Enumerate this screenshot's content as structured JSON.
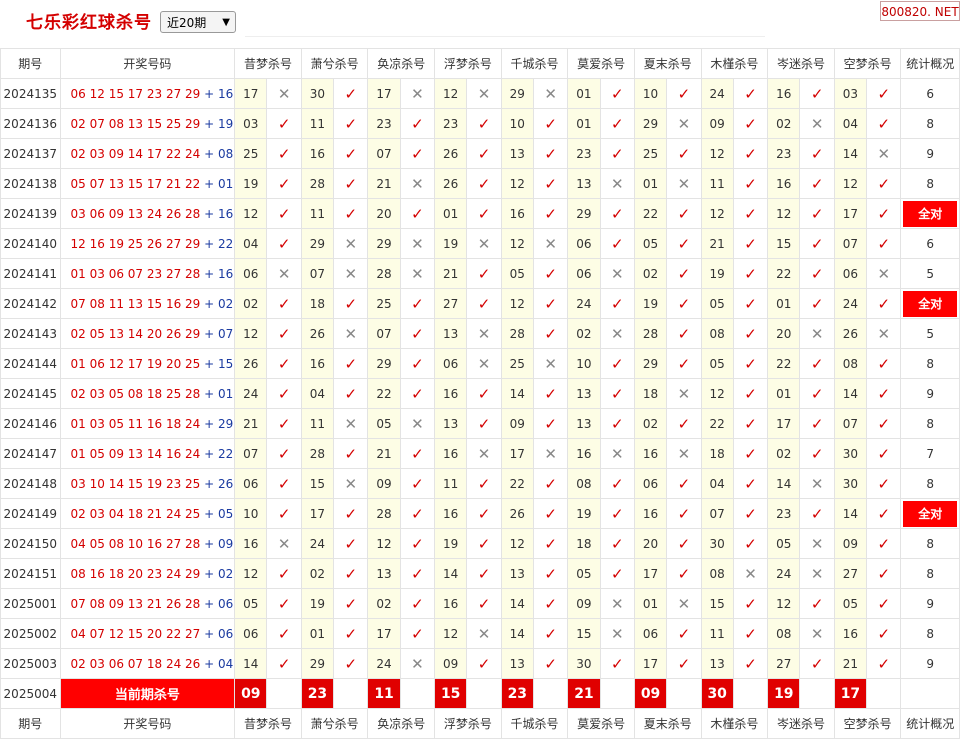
{
  "header": {
    "title": "七乐彩红球杀号",
    "period_select": "近20期",
    "site": "800820. NET"
  },
  "columns": {
    "issue": "期号",
    "numbers": "开奖号码",
    "experts": [
      "昔梦杀号",
      "萧兮杀号",
      "奂凉杀号",
      "浮梦杀号",
      "千城杀号",
      "莫爱杀号",
      "夏末杀号",
      "木槿杀号",
      "岑迷杀号",
      "空梦杀号"
    ],
    "stats": "统计概况"
  },
  "rows": [
    {
      "issue": "2024135",
      "reds": "06 12 15 17 23 27 29",
      "blue": "16",
      "kills": [
        "17",
        "30",
        "17",
        "12",
        "29",
        "01",
        "10",
        "24",
        "16",
        "03"
      ],
      "marks": [
        "n",
        "y",
        "n",
        "n",
        "n",
        "y",
        "y",
        "y",
        "y",
        "y"
      ],
      "stat": "6"
    },
    {
      "issue": "2024136",
      "reds": "02 07 08 13 15 25 29",
      "blue": "19",
      "kills": [
        "03",
        "11",
        "23",
        "23",
        "10",
        "01",
        "29",
        "09",
        "02",
        "04"
      ],
      "marks": [
        "y",
        "y",
        "y",
        "y",
        "y",
        "y",
        "n",
        "y",
        "n",
        "y"
      ],
      "stat": "8"
    },
    {
      "issue": "2024137",
      "reds": "02 03 09 14 17 22 24",
      "blue": "08",
      "kills": [
        "25",
        "16",
        "07",
        "26",
        "13",
        "23",
        "25",
        "12",
        "23",
        "14"
      ],
      "marks": [
        "y",
        "y",
        "y",
        "y",
        "y",
        "y",
        "y",
        "y",
        "y",
        "n"
      ],
      "stat": "9"
    },
    {
      "issue": "2024138",
      "reds": "05 07 13 15 17 21 22",
      "blue": "01",
      "kills": [
        "19",
        "28",
        "21",
        "26",
        "12",
        "13",
        "01",
        "11",
        "16",
        "12"
      ],
      "marks": [
        "y",
        "y",
        "n",
        "y",
        "y",
        "n",
        "n",
        "y",
        "y",
        "y"
      ],
      "stat": "8"
    },
    {
      "issue": "2024139",
      "reds": "03 06 09 13 24 26 28",
      "blue": "16",
      "kills": [
        "12",
        "11",
        "20",
        "01",
        "16",
        "29",
        "22",
        "12",
        "12",
        "17"
      ],
      "marks": [
        "y",
        "y",
        "y",
        "y",
        "y",
        "y",
        "y",
        "y",
        "y",
        "y"
      ],
      "stat": "全对"
    },
    {
      "issue": "2024140",
      "reds": "12 16 19 25 26 27 29",
      "blue": "22",
      "kills": [
        "04",
        "29",
        "29",
        "19",
        "12",
        "06",
        "05",
        "21",
        "15",
        "07"
      ],
      "marks": [
        "y",
        "n",
        "n",
        "n",
        "n",
        "y",
        "y",
        "y",
        "y",
        "y"
      ],
      "stat": "6"
    },
    {
      "issue": "2024141",
      "reds": "01 03 06 07 23 27 28",
      "blue": "16",
      "kills": [
        "06",
        "07",
        "28",
        "21",
        "05",
        "06",
        "02",
        "19",
        "22",
        "06"
      ],
      "marks": [
        "n",
        "n",
        "n",
        "y",
        "y",
        "n",
        "y",
        "y",
        "y",
        "n"
      ],
      "stat": "5"
    },
    {
      "issue": "2024142",
      "reds": "07 08 11 13 15 16 29",
      "blue": "02",
      "kills": [
        "02",
        "18",
        "25",
        "27",
        "12",
        "24",
        "19",
        "05",
        "01",
        "24"
      ],
      "marks": [
        "y",
        "y",
        "y",
        "y",
        "y",
        "y",
        "y",
        "y",
        "y",
        "y"
      ],
      "stat": "全对"
    },
    {
      "issue": "2024143",
      "reds": "02 05 13 14 20 26 29",
      "blue": "07",
      "kills": [
        "12",
        "26",
        "07",
        "13",
        "28",
        "02",
        "28",
        "08",
        "20",
        "26"
      ],
      "marks": [
        "y",
        "n",
        "y",
        "n",
        "y",
        "n",
        "y",
        "y",
        "n",
        "n"
      ],
      "stat": "5"
    },
    {
      "issue": "2024144",
      "reds": "01 06 12 17 19 20 25",
      "blue": "15",
      "kills": [
        "26",
        "16",
        "29",
        "06",
        "25",
        "10",
        "29",
        "05",
        "22",
        "08"
      ],
      "marks": [
        "y",
        "y",
        "y",
        "n",
        "n",
        "y",
        "y",
        "y",
        "y",
        "y"
      ],
      "stat": "8"
    },
    {
      "issue": "2024145",
      "reds": "02 03 05 08 18 25 28",
      "blue": "01",
      "kills": [
        "24",
        "04",
        "22",
        "16",
        "14",
        "13",
        "18",
        "12",
        "01",
        "14"
      ],
      "marks": [
        "y",
        "y",
        "y",
        "y",
        "y",
        "y",
        "n",
        "y",
        "y",
        "y"
      ],
      "stat": "9"
    },
    {
      "issue": "2024146",
      "reds": "01 03 05 11 16 18 24",
      "blue": "29",
      "kills": [
        "21",
        "11",
        "05",
        "13",
        "09",
        "13",
        "02",
        "22",
        "17",
        "07"
      ],
      "marks": [
        "y",
        "n",
        "n",
        "y",
        "y",
        "y",
        "y",
        "y",
        "y",
        "y"
      ],
      "stat": "8"
    },
    {
      "issue": "2024147",
      "reds": "01 05 09 13 14 16 24",
      "blue": "22",
      "kills": [
        "07",
        "28",
        "21",
        "16",
        "17",
        "16",
        "16",
        "18",
        "02",
        "30"
      ],
      "marks": [
        "y",
        "y",
        "y",
        "n",
        "n",
        "n",
        "n",
        "y",
        "y",
        "y"
      ],
      "stat": "7"
    },
    {
      "issue": "2024148",
      "reds": "03 10 14 15 19 23 25",
      "blue": "26",
      "kills": [
        "06",
        "15",
        "09",
        "11",
        "22",
        "08",
        "06",
        "04",
        "14",
        "30"
      ],
      "marks": [
        "y",
        "n",
        "y",
        "y",
        "y",
        "y",
        "y",
        "y",
        "n",
        "y"
      ],
      "stat": "8"
    },
    {
      "issue": "2024149",
      "reds": "02 03 04 18 21 24 25",
      "blue": "05",
      "kills": [
        "10",
        "17",
        "28",
        "16",
        "26",
        "19",
        "16",
        "07",
        "23",
        "14"
      ],
      "marks": [
        "y",
        "y",
        "y",
        "y",
        "y",
        "y",
        "y",
        "y",
        "y",
        "y"
      ],
      "stat": "全对"
    },
    {
      "issue": "2024150",
      "reds": "04 05 08 10 16 27 28",
      "blue": "09",
      "kills": [
        "16",
        "24",
        "12",
        "19",
        "12",
        "18",
        "20",
        "30",
        "05",
        "09"
      ],
      "marks": [
        "n",
        "y",
        "y",
        "y",
        "y",
        "y",
        "y",
        "y",
        "n",
        "y"
      ],
      "stat": "8"
    },
    {
      "issue": "2024151",
      "reds": "08 16 18 20 23 24 29",
      "blue": "02",
      "kills": [
        "12",
        "02",
        "13",
        "14",
        "13",
        "05",
        "17",
        "08",
        "24",
        "27"
      ],
      "marks": [
        "y",
        "y",
        "y",
        "y",
        "y",
        "y",
        "y",
        "n",
        "n",
        "y"
      ],
      "stat": "8"
    },
    {
      "issue": "2025001",
      "reds": "07 08 09 13 21 26 28",
      "blue": "06",
      "kills": [
        "05",
        "19",
        "02",
        "16",
        "14",
        "09",
        "01",
        "15",
        "12",
        "05"
      ],
      "marks": [
        "y",
        "y",
        "y",
        "y",
        "y",
        "n",
        "n",
        "y",
        "y",
        "y"
      ],
      "stat": "9"
    },
    {
      "issue": "2025002",
      "reds": "04 07 12 15 20 22 27",
      "blue": "06",
      "kills": [
        "06",
        "01",
        "17",
        "12",
        "14",
        "15",
        "06",
        "11",
        "08",
        "16"
      ],
      "marks": [
        "y",
        "y",
        "y",
        "n",
        "y",
        "n",
        "y",
        "y",
        "n",
        "y"
      ],
      "stat": "8"
    },
    {
      "issue": "2025003",
      "reds": "02 03 06 07 18 24 26",
      "blue": "04",
      "kills": [
        "14",
        "29",
        "24",
        "09",
        "13",
        "30",
        "17",
        "13",
        "27",
        "21"
      ],
      "marks": [
        "y",
        "y",
        "n",
        "y",
        "y",
        "y",
        "y",
        "y",
        "y",
        "y"
      ],
      "stat": "9"
    }
  ],
  "current": {
    "issue": "2025004",
    "label": "当前期杀号",
    "kills": [
      "09",
      "23",
      "11",
      "15",
      "23",
      "21",
      "09",
      "30",
      "19",
      "17"
    ]
  },
  "glyphs": {
    "ok": "✓",
    "no": "✕"
  }
}
